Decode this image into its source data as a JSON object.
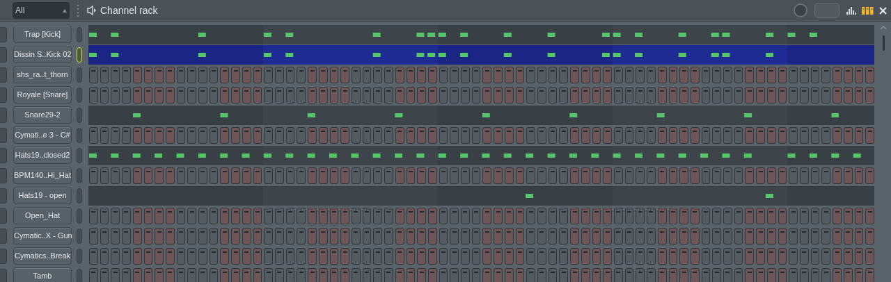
{
  "header": {
    "filter": {
      "value": "All"
    },
    "title": "Channel rack",
    "view_buttons": [
      {
        "kind": "graph",
        "selected": false
      },
      {
        "kind": "steps",
        "selected": true
      }
    ]
  },
  "channels": [
    {
      "name": "Trap [Kick]",
      "kind": "roll",
      "selected": false
    },
    {
      "name": "Dissin S..Kick 02",
      "kind": "roll",
      "selected": true
    },
    {
      "name": "shs_ra..t_thorn",
      "kind": "steps",
      "selected": false
    },
    {
      "name": "Royale [Snare]",
      "kind": "steps",
      "selected": false
    },
    {
      "name": "Snare29-2",
      "kind": "roll",
      "selected": false
    },
    {
      "name": "Cymati..e 3 - C#",
      "kind": "steps",
      "selected": false
    },
    {
      "name": "Hats19..closed2",
      "kind": "roll",
      "selected": false
    },
    {
      "name": "BPM140..Hi_Hat",
      "kind": "steps",
      "selected": false
    },
    {
      "name": "Hats19 - open",
      "kind": "roll",
      "selected": false
    },
    {
      "name": "Open_Hat",
      "kind": "steps",
      "selected": false
    },
    {
      "name": "Cymatic..X - Gun",
      "kind": "steps",
      "selected": false
    },
    {
      "name": "Cymatics..Break",
      "kind": "steps",
      "selected": false
    },
    {
      "name": "Tamb",
      "kind": "steps",
      "selected": false
    }
  ]
}
